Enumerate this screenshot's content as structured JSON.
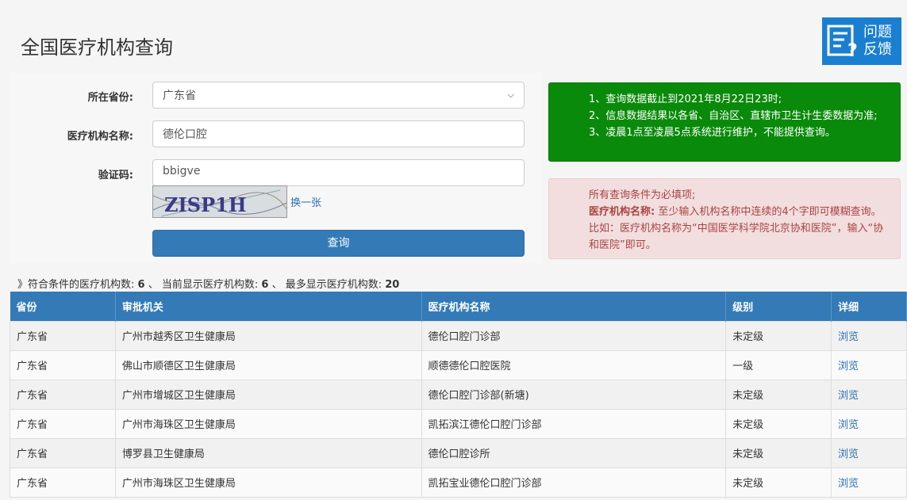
{
  "page": {
    "title": "全国医疗机构查询"
  },
  "feedback": {
    "line1": "问题",
    "line2": "反馈"
  },
  "form": {
    "province_label": "所在省份:",
    "province_value": "广东省",
    "name_label": "医疗机构名称:",
    "name_value": "德伦口腔",
    "captcha_label": "验证码:",
    "captcha_value": "bbigve",
    "captcha_text": "ZISP1H",
    "captcha_refresh": "换一张",
    "submit_label": "查询"
  },
  "notice_green": {
    "line1": "1、查询数据截止到2021年8月22日23时;",
    "line2": "2、信息数据结果以各省、自治区、直辖市卫生计生委数据为准;",
    "line3": "3、凌晨1点至凌晨5点系统进行维护，不能提供查询。"
  },
  "notice_red": {
    "line1": "所有查询条件为必填项;",
    "bold_label": "医疗机构名称:",
    "line2": "至少输入机构名称中连续的4个字即可模糊查询。比如：医疗机构名称为“中国医学科学院北京协和医院”，输入“协和医院”即可。"
  },
  "summary": {
    "prefix": "》符合条件的医疗机构数:",
    "match_count": "6",
    "sep1": "、 当前显示医疗机构数:",
    "shown_count": "6",
    "sep2": "、 最多显示医疗机构数:",
    "max_count": "20"
  },
  "table": {
    "headers": [
      "省份",
      "审批机关",
      "医疗机构名称",
      "级别",
      "详细"
    ],
    "rows": [
      [
        "广东省",
        "广州市越秀区卫生健康局",
        "德伦口腔门诊部",
        "未定级",
        "浏览"
      ],
      [
        "广东省",
        "佛山市顺德区卫生健康局",
        "顺德德伦口腔医院",
        "一级",
        "浏览"
      ],
      [
        "广东省",
        "广州市增城区卫生健康局",
        "德伦口腔门诊部(新塘)",
        "未定级",
        "浏览"
      ],
      [
        "广东省",
        "广州市海珠区卫生健康局",
        "凯拓滨江德伦口腔门诊部",
        "未定级",
        "浏览"
      ],
      [
        "广东省",
        "博罗县卫生健康局",
        "德伦口腔诊所",
        "未定级",
        "浏览"
      ],
      [
        "广东省",
        "广州市海珠区卫生健康局",
        "凯拓宝业德伦口腔门诊部",
        "未定级",
        "浏览"
      ]
    ]
  }
}
